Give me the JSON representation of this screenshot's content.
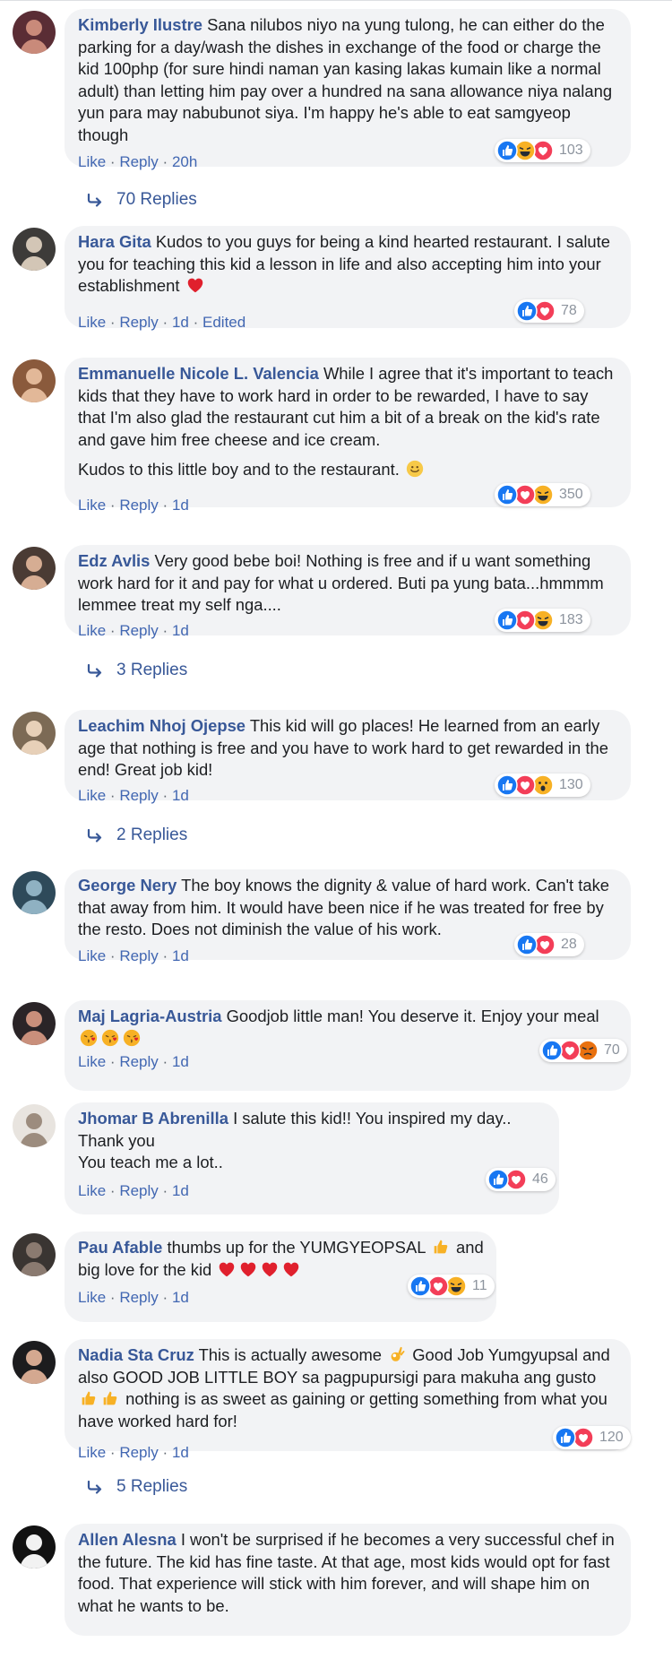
{
  "actions": {
    "like": "Like",
    "reply": "Reply",
    "separator": "·"
  },
  "comments": [
    {
      "author": "Kimberly Ilustre",
      "text": "Sana nilubos niyo na yung tulong, he can either do the parking for a day/wash the dishes in exchange of the food or charge the kid 100php (for sure hindi naman yan kasing lakas kumain like a normal adult) than letting him pay over a hundred na sana allowance niya nalang yun para may nabubunot siya. I'm happy he's able to eat samgyeop though",
      "time": "20h",
      "reaction_count": "103",
      "reactions": [
        "like-reaction",
        "haha-reaction",
        "love-reaction"
      ],
      "replies_label": "70 Replies"
    },
    {
      "author": "Hara Gita",
      "text": "Kudos to you guys for being a kind hearted restaurant. I salute you for teaching this kid a lesson in life and also accepting him into your establishment",
      "text_emoji": [
        "heart-emoji"
      ],
      "time": "1d",
      "edited": "Edited",
      "reaction_count": "78",
      "reactions": [
        "like-reaction",
        "love-reaction"
      ]
    },
    {
      "author": "Emmanuelle Nicole L. Valencia",
      "text": "While I agree that it's important to teach kids that they have to work hard in order to be rewarded, I have to say that I'm also glad the restaurant cut him a bit of a break on the kid's rate and gave him free cheese and ice cream.",
      "text2": "Kudos to this little boy and to the restaurant.",
      "text2_emoji": [
        "smile-emoji"
      ],
      "time": "1d",
      "reaction_count": "350",
      "reactions": [
        "like-reaction",
        "love-reaction",
        "haha-reaction"
      ]
    },
    {
      "author": "Edz Avlis",
      "text": "Very good bebe boi! Nothing is free and if u want something work hard for it and pay for what u ordered. Buti pa yung bata...hmmmm lemmee treat my self nga....",
      "time": "1d",
      "reaction_count": "183",
      "reactions": [
        "like-reaction",
        "love-reaction",
        "haha-reaction"
      ],
      "replies_label": "3 Replies"
    },
    {
      "author": "Leachim Nhoj Ojepse",
      "text": "This kid will go places! He learned from an early age that nothing is free and you have to work hard to get rewarded in the end! Great job kid!",
      "time": "1d",
      "reaction_count": "130",
      "reactions": [
        "like-reaction",
        "love-reaction",
        "wow-reaction"
      ],
      "replies_label": "2 Replies"
    },
    {
      "author": "George Nery",
      "text": "The boy knows the dignity & value of hard work. Can't take that away from him. It would have been nice if he was treated for free by the resto. Does not diminish the value of his work.",
      "time": "1d",
      "reaction_count": "28",
      "reactions": [
        "like-reaction",
        "love-reaction"
      ]
    },
    {
      "author": "Maj Lagria-Austria",
      "text": "Goodjob little man! You deserve it. Enjoy your meal",
      "text_emoji": [
        "kiss-emoji",
        "kiss-emoji",
        "kiss-emoji"
      ],
      "time": "1d",
      "reaction_count": "70",
      "reactions": [
        "like-reaction",
        "love-reaction",
        "angry-reaction"
      ]
    },
    {
      "author": "Jhomar B Abrenilla",
      "text": "I salute this kid!! You inspired my day..\nThank you\nYou teach me a lot..",
      "time": "1d",
      "reaction_count": "46",
      "reactions": [
        "like-reaction",
        "love-reaction"
      ]
    },
    {
      "author": "Pau Afable",
      "text": "thumbs up for the YUMGYEOPSAL",
      "text_emoji_inline": [
        "thumbs-up-emoji"
      ],
      "text_after": "and big love for the kid",
      "text_emoji": [
        "heart-emoji",
        "heart-emoji",
        "heart-emoji",
        "heart-emoji"
      ],
      "time": "1d",
      "reaction_count": "11",
      "reactions": [
        "like-reaction",
        "love-reaction",
        "haha-reaction"
      ]
    },
    {
      "author": "Nadia Sta Cruz",
      "text": "This is actually awesome",
      "text_emoji_inline": [
        "ok-hand-emoji"
      ],
      "text_after": "Good Job Yumgyupsal and also GOOD JOB LITTLE BOY sa pagpupursigi para makuha ang gusto",
      "text_emoji_inline2": [
        "thumbs-up-emoji",
        "thumbs-up-emoji"
      ],
      "text_after2": "nothing is as sweet as gaining or getting something from what you have worked hard for!",
      "time": "1d",
      "reaction_count": "120",
      "reactions": [
        "like-reaction",
        "love-reaction"
      ],
      "replies_label": "5 Replies"
    },
    {
      "author": "Allen Alesna",
      "text": "I won't be surprised if he becomes a very successful chef in the future. The kid has fine taste. At that age, most kids would opt for fast food. That experience will stick with him forever, and will shape him on what he wants to be."
    }
  ],
  "colors": {
    "author": "#385898",
    "link": "#4267b2",
    "meta": "#606770",
    "bubble": "#f2f3f5",
    "like": "#1877f2",
    "love": "#f33e58",
    "haha": "#f7b125"
  }
}
